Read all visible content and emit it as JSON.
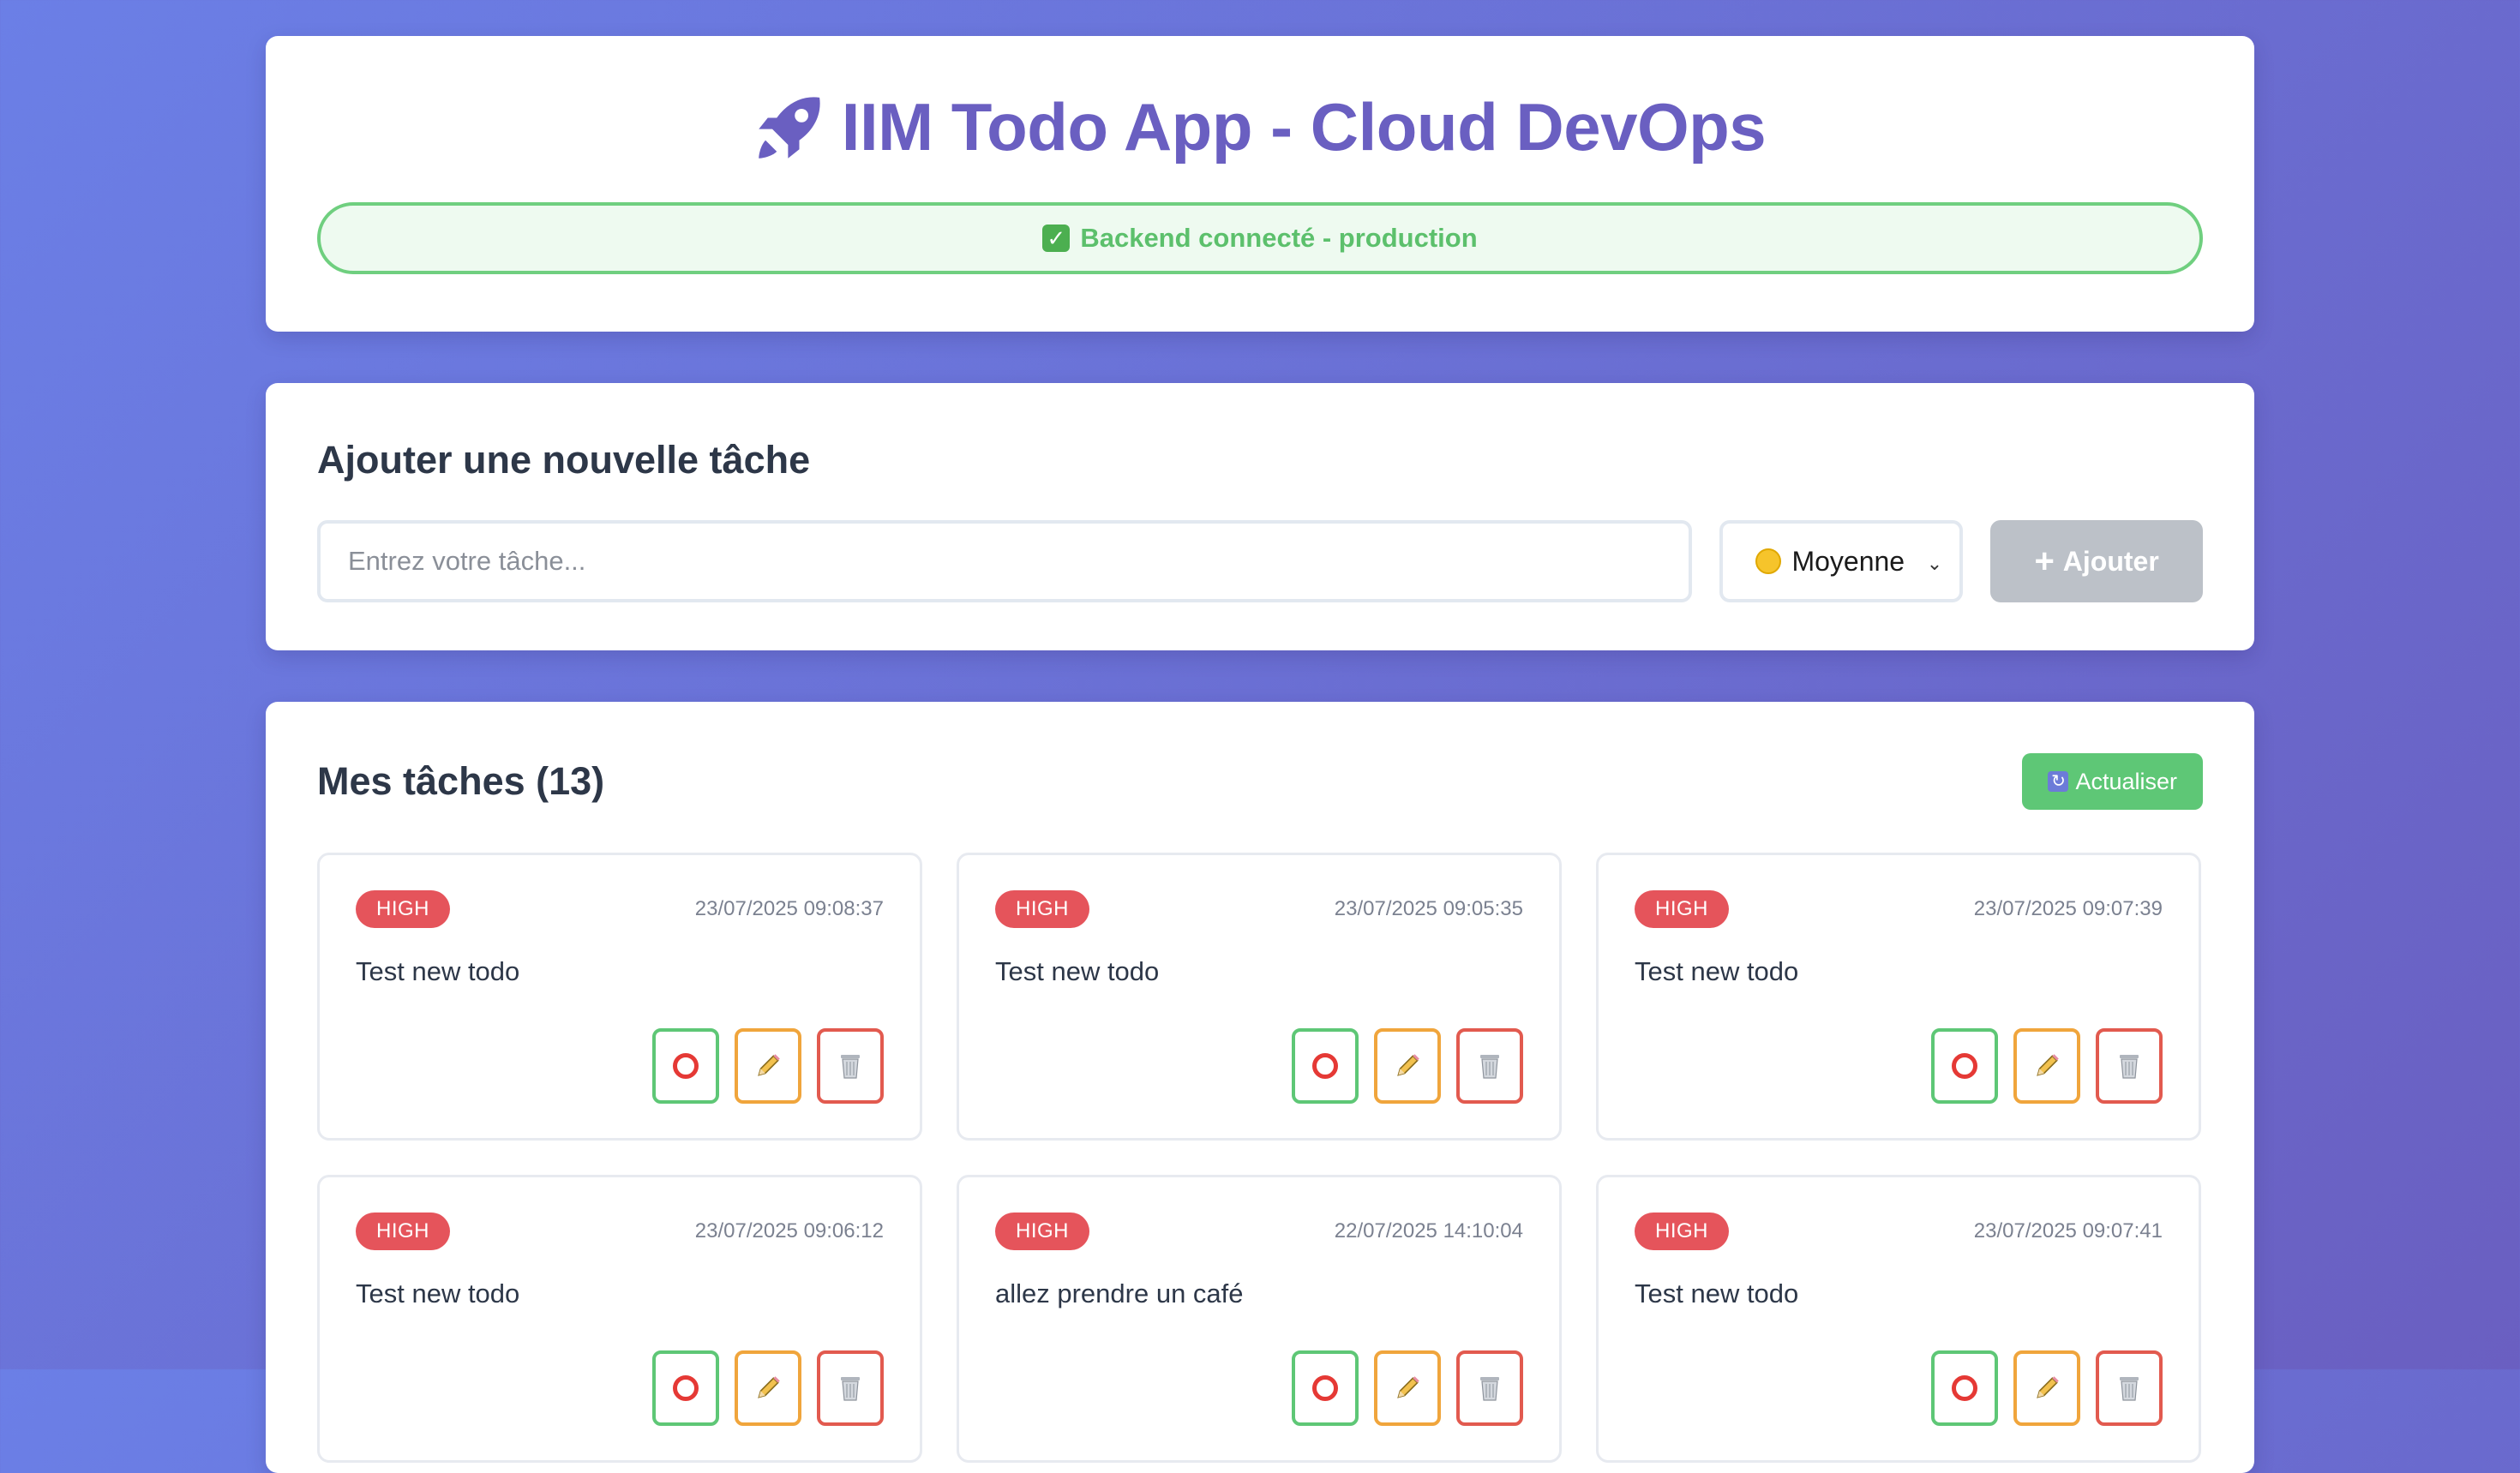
{
  "header": {
    "title": "IIM Todo App - Cloud DevOps",
    "status": "Backend connecté - production"
  },
  "add_task": {
    "section_title": "Ajouter une nouvelle tâche",
    "input_placeholder": "Entrez votre tâche...",
    "priority_selected": "Moyenne",
    "add_label": "Ajouter"
  },
  "tasks": {
    "title": "Mes tâches (13)",
    "refresh_label": "Actualiser",
    "items": [
      {
        "priority": "HIGH",
        "date": "23/07/2025 09:08:37",
        "text": "Test new todo"
      },
      {
        "priority": "HIGH",
        "date": "23/07/2025 09:05:35",
        "text": "Test new todo"
      },
      {
        "priority": "HIGH",
        "date": "23/07/2025 09:07:39",
        "text": "Test new todo"
      },
      {
        "priority": "HIGH",
        "date": "23/07/2025 09:06:12",
        "text": "Test new todo"
      },
      {
        "priority": "HIGH",
        "date": "22/07/2025 14:10:04",
        "text": "allez prendre un café"
      },
      {
        "priority": "HIGH",
        "date": "23/07/2025 09:07:41",
        "text": "Test new todo"
      }
    ]
  },
  "colors": {
    "accent": "#6a5fc1",
    "status_green": "#5cc06c",
    "high_badge": "#e5545b",
    "refresh_green": "#5ec776"
  },
  "icons": {
    "title": "rocket-icon",
    "status": "check-mark-icon",
    "priority": "yellow-circle-icon",
    "add": "plus-icon",
    "refresh": "refresh-icon",
    "toggle": "circle-icon",
    "edit": "pencil-icon",
    "delete": "trash-icon"
  }
}
